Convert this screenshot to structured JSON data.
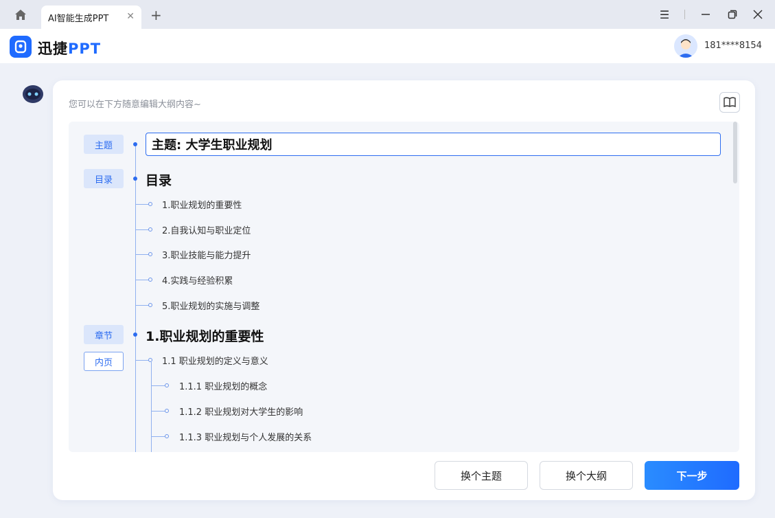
{
  "window": {
    "tab_title": "AI智能生成PPT"
  },
  "app": {
    "brand_cn": "迅捷",
    "brand_en": "PPT",
    "username": "181****8154"
  },
  "card": {
    "hint": "您可以在下方随意编辑大纲内容~"
  },
  "outline": {
    "tags": {
      "theme": "主题",
      "toc": "目录",
      "chapter": "章节",
      "page": "内页"
    },
    "title_value": "主题: 大学生职业规划",
    "toc_heading": "目录",
    "toc_items": [
      "1.职业规划的重要性",
      "2.自我认知与职业定位",
      "3.职业技能与能力提升",
      "4.实践与经验积累",
      "5.职业规划的实施与调整"
    ],
    "chapter_heading": "1.职业规划的重要性",
    "section": "1.1 职业规划的定义与意义",
    "subsections": [
      "1.1.1 职业规划的概念",
      "1.1.2 职业规划对大学生的影响",
      "1.1.3 职业规划与个人发展的关系"
    ]
  },
  "buttons": {
    "change_theme": "换个主题",
    "change_outline": "换个大纲",
    "next": "下一步"
  }
}
